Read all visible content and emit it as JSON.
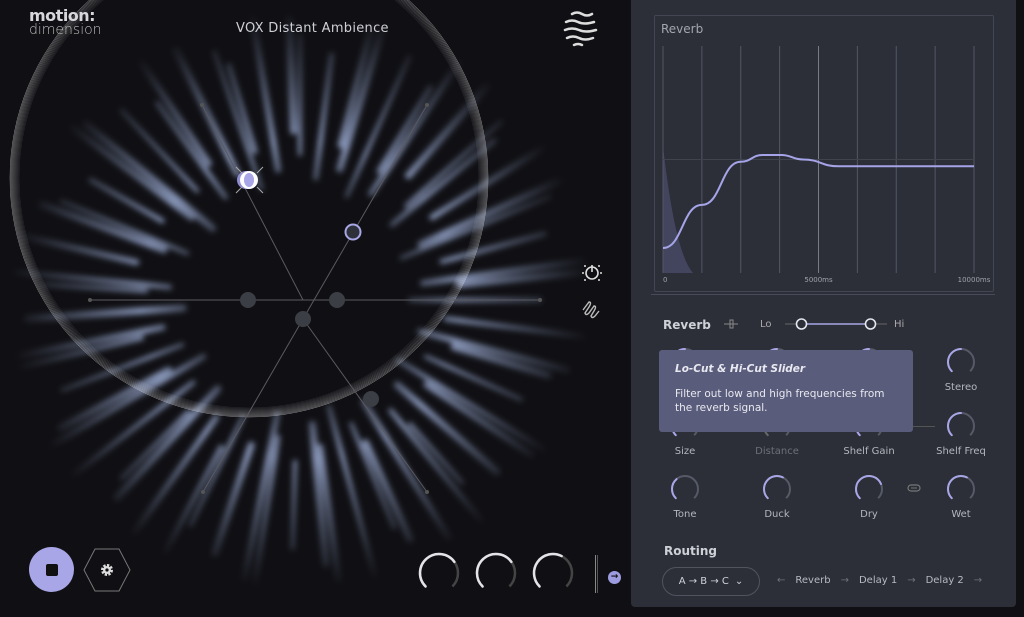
{
  "header": {
    "logo_top": "motion:",
    "logo_bottom": "dimension",
    "preset_name": "VOX Distant Ambience",
    "logo_icon": "waves-icon"
  },
  "side_icons": [
    "power-timer-icon",
    "squiggle-icon"
  ],
  "transport": {
    "play_state": "stopped",
    "stop_icon": "stop-icon",
    "settings_icon": "gear-icon"
  },
  "macro_knobs": [
    0.7,
    0.7,
    0.6
  ],
  "panel": {
    "chart_data": {
      "type": "line",
      "title": "Reverb",
      "x_ticks": [
        "0",
        "5000ms",
        "10000ms"
      ],
      "xlim": [
        0,
        10000
      ],
      "x_grid_step": 1250,
      "grid": true,
      "points": [
        [
          0,
          0.11
        ],
        [
          1250,
          0.3
        ],
        [
          2500,
          0.49
        ],
        [
          3200,
          0.52
        ],
        [
          3800,
          0.52
        ],
        [
          4500,
          0.5
        ],
        [
          5650,
          0.47
        ],
        [
          7500,
          0.47
        ],
        [
          10000,
          0.47
        ]
      ],
      "line_color": "#a6a4e8"
    },
    "reverb_label": "Reverb",
    "lo_label": "Lo",
    "hi_label": "Hi",
    "lo_value": 0.15,
    "hi_value": 0.85,
    "knobs": [
      {
        "label": "",
        "value": 0.5
      },
      {
        "label": "",
        "value": 0.5
      },
      {
        "label": "",
        "value": 0.5
      },
      {
        "label": "Stereo",
        "value": 0.5
      },
      {
        "label": "Size",
        "value": 0.5
      },
      {
        "label": "Distance",
        "value": 0.5,
        "disabled": true
      },
      {
        "label": "Shelf Gain",
        "value": 0.5
      },
      {
        "label": "Shelf Freq",
        "value": 0.5
      },
      {
        "label": "Tone",
        "value": 0.35
      },
      {
        "label": "Duck",
        "value": 0.6
      },
      {
        "label": "Dry",
        "value": 0.75
      },
      {
        "label": "Wet",
        "value": 0.6
      }
    ],
    "tooltip": {
      "title": "Lo-Cut & Hi-Cut Slider",
      "body": "Filter out low and high frequencies from the reverb signal."
    },
    "routing": {
      "label": "Routing",
      "selected": "A → B → C",
      "chain": [
        "Reverb",
        "Delay 1",
        "Delay 2"
      ]
    }
  },
  "colors": {
    "accent": "#a8a6e6",
    "panel": "#2c2f38",
    "background": "#101014"
  }
}
